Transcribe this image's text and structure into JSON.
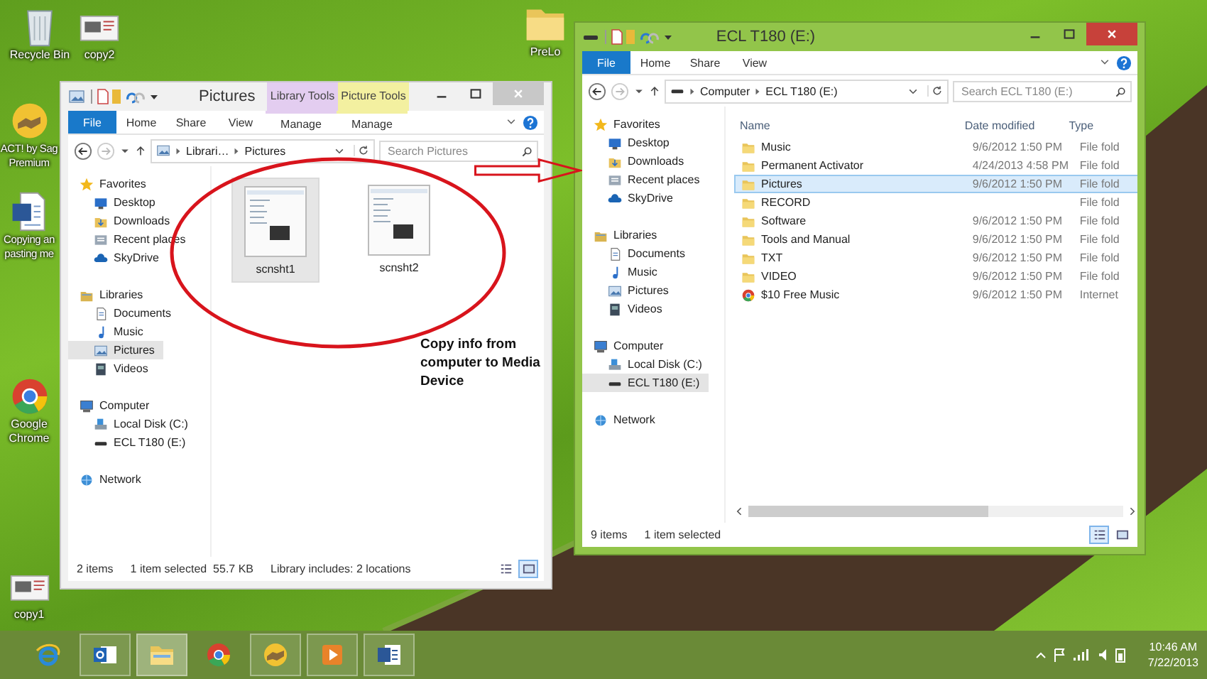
{
  "desktop_icons": [
    {
      "label": "Recycle Bin",
      "kind": "recycle"
    },
    {
      "label": "copy2",
      "kind": "image"
    },
    {
      "label": "PreLo",
      "kind": "folder"
    },
    {
      "label": "ACT! by Sag Premium",
      "kind": "act"
    },
    {
      "label": "Copying an pasting me",
      "kind": "word"
    },
    {
      "label": "Google Chrome",
      "kind": "chrome"
    },
    {
      "label": "copy1",
      "kind": "image"
    }
  ],
  "windows": [
    {
      "title": "Pictures",
      "active": false,
      "kind": "library",
      "contexts": [
        {
          "label": "Library Tools",
          "color": "#e3cdf0",
          "tab": "Manage"
        },
        {
          "label": "Picture Tools",
          "color": "#f3f0a0",
          "tab": "Manage"
        }
      ],
      "ribbon_tabs": [
        {
          "label": "File",
          "kind": "file"
        },
        {
          "label": "Home",
          "kind": "tab"
        },
        {
          "label": "Share",
          "kind": "tab"
        },
        {
          "label": "View",
          "kind": "tab"
        }
      ],
      "forward_disabled": true,
      "address": {
        "crumbs": [
          "Librari…",
          "Pictures"
        ]
      },
      "search_placeholder": "Search Pictures",
      "nav": [
        {
          "label": "Favorites",
          "kind": "star",
          "selected": false,
          "children": [
            {
              "label": "Desktop",
              "kind": "desktop",
              "selected": false
            },
            {
              "label": "Downloads",
              "kind": "downloads",
              "selected": false
            },
            {
              "label": "Recent places",
              "kind": "recent",
              "selected": false
            },
            {
              "label": "SkyDrive",
              "kind": "skydrive",
              "selected": false
            }
          ]
        },
        {
          "label": "Libraries",
          "kind": "libraries",
          "selected": false,
          "children": [
            {
              "label": "Documents",
              "kind": "documents",
              "selected": false
            },
            {
              "label": "Music",
              "kind": "music",
              "selected": false
            },
            {
              "label": "Pictures",
              "kind": "pictures",
              "selected": true
            },
            {
              "label": "Videos",
              "kind": "videos",
              "selected": false
            }
          ]
        },
        {
          "label": "Computer",
          "kind": "computer",
          "selected": false,
          "children": [
            {
              "label": "Local Disk (C:)",
              "kind": "disk",
              "selected": false
            },
            {
              "label": "ECL T180 (E:)",
              "kind": "drive",
              "selected": false
            }
          ]
        },
        {
          "label": "Network",
          "kind": "network",
          "selected": false
        }
      ],
      "content": {
        "kind": "thumbnails",
        "items": [
          {
            "label": "scnsht1",
            "selected": true
          },
          {
            "label": "scnsht2",
            "selected": false
          }
        ]
      },
      "status": [
        "2 items",
        "1 item selected  55.7 KB",
        "Library includes: 2 locations"
      ],
      "view_buttons": [
        {
          "kind": "details",
          "selected": false
        },
        {
          "kind": "icons",
          "selected": true
        }
      ]
    },
    {
      "title": "ECL T180 (E:)",
      "active": true,
      "kind": "drive",
      "ribbon_tabs": [
        {
          "label": "File",
          "kind": "file"
        },
        {
          "label": "Home",
          "kind": "tab"
        },
        {
          "label": "Share",
          "kind": "tab"
        },
        {
          "label": "View",
          "kind": "tab"
        }
      ],
      "forward_disabled": true,
      "address": {
        "crumbs": [
          "Computer",
          "ECL T180 (E:)"
        ]
      },
      "search_placeholder": "Search ECL T180 (E:)",
      "nav": [
        {
          "label": "Favorites",
          "kind": "star",
          "selected": false,
          "children": [
            {
              "label": "Desktop",
              "kind": "desktop",
              "selected": false
            },
            {
              "label": "Downloads",
              "kind": "downloads",
              "selected": false
            },
            {
              "label": "Recent places",
              "kind": "recent",
              "selected": false
            },
            {
              "label": "SkyDrive",
              "kind": "skydrive",
              "selected": false
            }
          ]
        },
        {
          "label": "Libraries",
          "kind": "libraries",
          "selected": false,
          "children": [
            {
              "label": "Documents",
              "kind": "documents",
              "selected": false
            },
            {
              "label": "Music",
              "kind": "music",
              "selected": false
            },
            {
              "label": "Pictures",
              "kind": "pictures",
              "selected": false
            },
            {
              "label": "Videos",
              "kind": "videos",
              "selected": false
            }
          ]
        },
        {
          "label": "Computer",
          "kind": "computer",
          "selected": false,
          "children": [
            {
              "label": "Local Disk (C:)",
              "kind": "disk",
              "selected": false
            },
            {
              "label": "ECL T180 (E:)",
              "kind": "drive",
              "selected": true
            }
          ]
        },
        {
          "label": "Network",
          "kind": "network",
          "selected": false
        }
      ],
      "content": {
        "kind": "details",
        "columns": [
          "Name",
          "Date modified",
          "Type"
        ],
        "rows": [
          {
            "name": "Music",
            "date": "9/6/2012 1:50 PM",
            "type": "File fold",
            "kind": "folder",
            "selected": false
          },
          {
            "name": "Permanent Activator",
            "date": "4/24/2013 4:58 PM",
            "type": "File fold",
            "kind": "folder",
            "selected": false
          },
          {
            "name": "Pictures",
            "date": "9/6/2012 1:50 PM",
            "type": "File fold",
            "kind": "folder",
            "selected": true
          },
          {
            "name": "RECORD",
            "date": "",
            "type": "File fold",
            "kind": "folder",
            "selected": false
          },
          {
            "name": "Software",
            "date": "9/6/2012 1:50 PM",
            "type": "File fold",
            "kind": "folder",
            "selected": false
          },
          {
            "name": "Tools and Manual",
            "date": "9/6/2012 1:50 PM",
            "type": "File fold",
            "kind": "folder",
            "selected": false
          },
          {
            "name": "TXT",
            "date": "9/6/2012 1:50 PM",
            "type": "File fold",
            "kind": "folder",
            "selected": false
          },
          {
            "name": "VIDEO",
            "date": "9/6/2012 1:50 PM",
            "type": "File fold",
            "kind": "folder",
            "selected": false
          },
          {
            "name": "$10 Free Music",
            "date": "9/6/2012 1:50 PM",
            "type": "Internet",
            "kind": "web",
            "selected": false
          }
        ]
      },
      "status": [
        "9 items",
        "1 item selected"
      ],
      "view_buttons": [
        {
          "kind": "details",
          "selected": true
        },
        {
          "kind": "icons",
          "selected": false
        }
      ]
    }
  ],
  "annotation": {
    "text": "Copy info from computer to Media Device"
  },
  "taskbar": {
    "apps": [
      {
        "kind": "ie",
        "running": false,
        "selected": false
      },
      {
        "kind": "outlook",
        "running": true,
        "selected": false
      },
      {
        "kind": "explorer",
        "running": true,
        "selected": true
      },
      {
        "kind": "chrome",
        "running": false,
        "selected": false
      },
      {
        "kind": "act",
        "running": true,
        "selected": false
      },
      {
        "kind": "media",
        "running": true,
        "selected": false
      },
      {
        "kind": "word",
        "running": true,
        "selected": false
      }
    ],
    "time": "10:46 AM",
    "date": "7/22/2013"
  }
}
